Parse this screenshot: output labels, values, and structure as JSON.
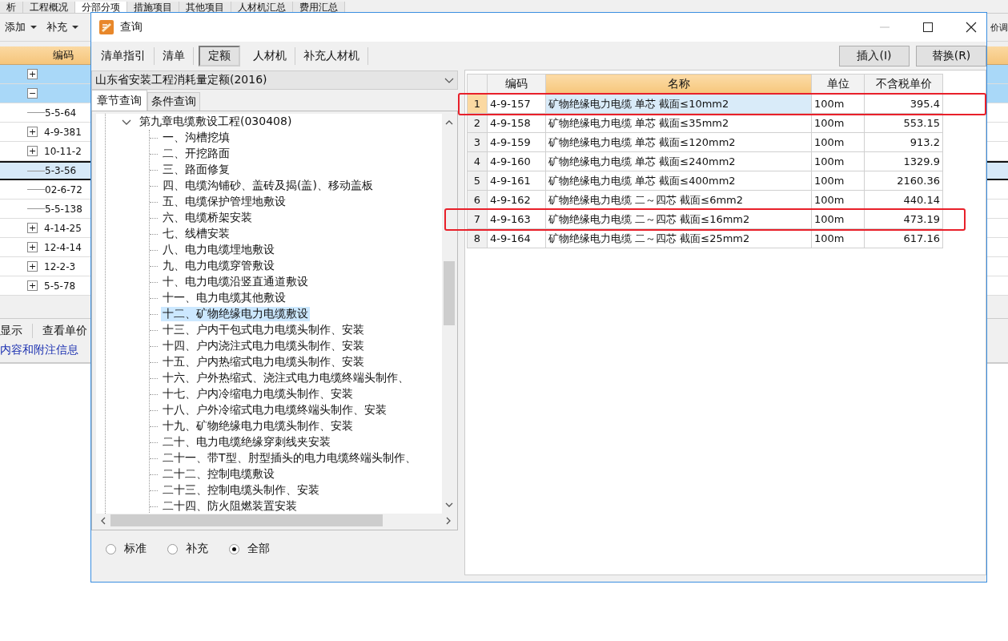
{
  "app": {
    "tabs": [
      {
        "label": "析",
        "selected": false
      },
      {
        "label": "工程概况",
        "selected": false
      },
      {
        "label": "分部分项",
        "selected": true
      },
      {
        "label": "措施项目",
        "selected": false
      },
      {
        "label": "其他项目",
        "selected": false
      },
      {
        "label": "人材机汇总",
        "selected": false
      },
      {
        "label": "费用汇总",
        "selected": false
      }
    ],
    "toolbar": [
      {
        "label": "添加"
      },
      {
        "label": "补充"
      }
    ],
    "toolbar_right": "价调",
    "grid": {
      "column": "编码",
      "rows": [
        {
          "code": "",
          "expander": "+",
          "highlighted": true,
          "selected": false
        },
        {
          "code": "",
          "expander": "−",
          "highlighted": true,
          "selected": false
        },
        {
          "code": "5-5-64",
          "highlighted": false,
          "selected": false
        },
        {
          "code": "4-9-381",
          "expander": "+",
          "highlighted": false,
          "selected": false
        },
        {
          "code": "10-11-2",
          "expander": "+",
          "highlighted": false,
          "selected": false
        },
        {
          "code": "5-3-56",
          "highlighted": false,
          "selected": true
        },
        {
          "code": "02-6-72",
          "highlighted": false,
          "selected": false
        },
        {
          "code": "5-5-138",
          "highlighted": false,
          "selected": false
        },
        {
          "code": "4-14-25",
          "expander": "+",
          "highlighted": false,
          "selected": false
        },
        {
          "code": "12-4-14",
          "expander": "+",
          "highlighted": false,
          "selected": false
        },
        {
          "code": "12-2-3",
          "expander": "+",
          "highlighted": false,
          "selected": false
        },
        {
          "code": "5-5-78",
          "expander": "+",
          "highlighted": false,
          "selected": false
        }
      ]
    },
    "bottom_toolbar": [
      "显示",
      "查看单价"
    ],
    "info_link": "内容和附注信息"
  },
  "dialog": {
    "title": "查询",
    "tabs": [
      {
        "label": "清单指引",
        "selected": false
      },
      {
        "label": "清单",
        "selected": false
      },
      {
        "label": "定额",
        "selected": true
      },
      {
        "label": "人材机",
        "selected": false
      },
      {
        "label": "补充人材机",
        "selected": false
      }
    ],
    "buttons": [
      "插入(I)",
      "替换(R)"
    ],
    "library": "山东省安装工程消耗量定额(2016)",
    "subtabs": [
      {
        "label": "章节查询",
        "selected": true
      },
      {
        "label": "条件查询",
        "selected": false
      }
    ],
    "tree": {
      "label": "第九章电缆敷设工程(030408)",
      "expanded": true,
      "children": [
        {
          "label": "一、沟槽挖填",
          "selected": false
        },
        {
          "label": "二、开挖路面",
          "selected": false
        },
        {
          "label": "三、路面修复",
          "selected": false
        },
        {
          "label": "四、电缆沟铺砂、盖砖及揭(盖)、移动盖板",
          "selected": false
        },
        {
          "label": "五、电缆保护管埋地敷设",
          "selected": false
        },
        {
          "label": "六、电缆桥架安装",
          "selected": false
        },
        {
          "label": "七、线槽安装",
          "selected": false
        },
        {
          "label": "八、电力电缆埋地敷设",
          "selected": false
        },
        {
          "label": "九、电力电缆穿管敷设",
          "selected": false
        },
        {
          "label": "十、电力电缆沿竖直通道敷设",
          "selected": false
        },
        {
          "label": "十一、电力电缆其他敷设",
          "selected": false
        },
        {
          "label": "十二、矿物绝缘电力电缆敷设",
          "selected": true
        },
        {
          "label": "十三、户内干包式电力电缆头制作、安装",
          "selected": false
        },
        {
          "label": "十四、户内浇注式电力电缆头制作、安装",
          "selected": false
        },
        {
          "label": "十五、户内热缩式电力电缆头制作、安装",
          "selected": false
        },
        {
          "label": "十六、户外热缩式、浇注式电力电缆终端头制作、",
          "selected": false
        },
        {
          "label": "十七、户内冷缩电力电缆头制作、安装",
          "selected": false
        },
        {
          "label": "十八、户外冷缩式电力电缆终端头制作、安装",
          "selected": false
        },
        {
          "label": "十九、矿物绝缘电力电缆头制作、安装",
          "selected": false
        },
        {
          "label": "二十、电力电缆绝缘穿刺线夹安装",
          "selected": false
        },
        {
          "label": "二十一、带T型、肘型插头的电力电缆终端头制作、",
          "selected": false
        },
        {
          "label": "二十二、控制电缆敷设",
          "selected": false
        },
        {
          "label": "二十三、控制电缆头制作、安装",
          "selected": false
        },
        {
          "label": "二十四、防火阻燃装置安装",
          "selected": false
        }
      ]
    },
    "radios": [
      {
        "label": "标准",
        "selected": false
      },
      {
        "label": "补充",
        "selected": false
      },
      {
        "label": "全部",
        "selected": true
      }
    ],
    "table": {
      "columns": [
        {
          "label": "编码",
          "sorted": false
        },
        {
          "label": "名称",
          "sorted": true
        },
        {
          "label": "单位",
          "sorted": false
        },
        {
          "label": "不含税单价",
          "sorted": false
        }
      ],
      "rows": [
        {
          "index": "1",
          "code": "4-9-157",
          "name": "矿物绝缘电力电缆 单芯 截面≤10mm2",
          "unit": "100m",
          "price": "395.4",
          "selected": true,
          "marked": true
        },
        {
          "index": "2",
          "code": "4-9-158",
          "name": "矿物绝缘电力电缆 单芯 截面≤35mm2",
          "unit": "100m",
          "price": "553.15",
          "selected": false,
          "marked": false
        },
        {
          "index": "3",
          "code": "4-9-159",
          "name": "矿物绝缘电力电缆 单芯 截面≤120mm2",
          "unit": "100m",
          "price": "913.2",
          "selected": false,
          "marked": false
        },
        {
          "index": "4",
          "code": "4-9-160",
          "name": "矿物绝缘电力电缆 单芯 截面≤240mm2",
          "unit": "100m",
          "price": "1329.9",
          "selected": false,
          "marked": false
        },
        {
          "index": "5",
          "code": "4-9-161",
          "name": "矿物绝缘电力电缆 单芯 截面≤400mm2",
          "unit": "100m",
          "price": "2160.36",
          "selected": false,
          "marked": false
        },
        {
          "index": "6",
          "code": "4-9-162",
          "name": "矿物绝缘电力电缆 二～四芯 截面≤6mm2",
          "unit": "100m",
          "price": "440.14",
          "selected": false,
          "marked": false
        },
        {
          "index": "7",
          "code": "4-9-163",
          "name": "矿物绝缘电力电缆 二～四芯 截面≤16mm2",
          "unit": "100m",
          "price": "473.19",
          "selected": false,
          "marked": true
        },
        {
          "index": "8",
          "code": "4-9-164",
          "name": "矿物绝缘电力电缆 二～四芯 截面≤25mm2",
          "unit": "100m",
          "price": "617.16",
          "selected": false,
          "marked": false
        }
      ]
    }
  }
}
